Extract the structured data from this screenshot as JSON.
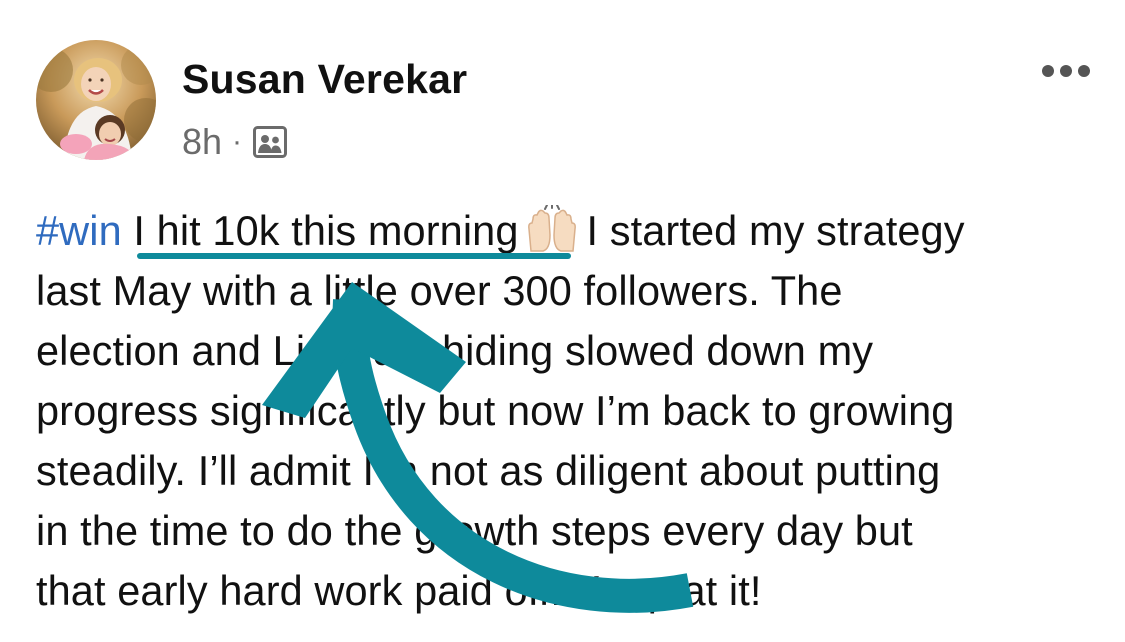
{
  "author": {
    "name": "Susan Verekar",
    "time": "8h",
    "separator": "·",
    "visibility_icon": "group-visibility-icon"
  },
  "menu": {
    "more_icon": "more-horizontal-icon",
    "dots": "•••"
  },
  "post": {
    "line1": {
      "hashtag": "#win",
      "highlight": "I hit 10k this morning",
      "emoji": "raising-hands-emoji",
      "rest": "I started my strategy"
    },
    "line2": "last May with a little over 300 followers. The",
    "line3": "election and LinkedIn hiding slowed down my",
    "line4": "progress significantly but now I’m back to growing",
    "line5": "steadily. I’ll admit I’m not as diligent about putting",
    "line6": "in the time to do the growth steps every day but",
    "line7": "that early hard work paid off. Keep at it!"
  },
  "annotation": {
    "arrow_color": "#0e8a9b",
    "underline_color": "#0e8a9b"
  },
  "colors": {
    "hashtag": "#2f6bbf",
    "meta": "#6b6b6b"
  }
}
